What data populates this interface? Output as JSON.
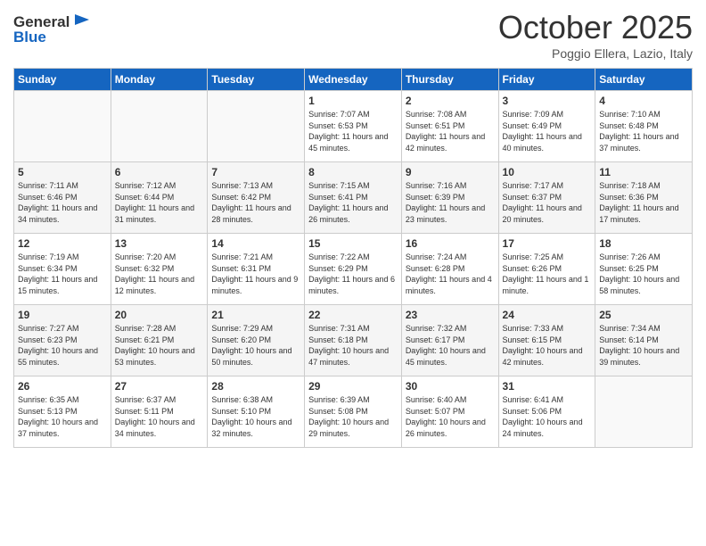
{
  "logo": {
    "general": "General",
    "blue": "Blue"
  },
  "header": {
    "month": "October 2025",
    "location": "Poggio Ellera, Lazio, Italy"
  },
  "weekdays": [
    "Sunday",
    "Monday",
    "Tuesday",
    "Wednesday",
    "Thursday",
    "Friday",
    "Saturday"
  ],
  "weeks": [
    [
      {
        "day": "",
        "sunrise": "",
        "sunset": "",
        "daylight": ""
      },
      {
        "day": "",
        "sunrise": "",
        "sunset": "",
        "daylight": ""
      },
      {
        "day": "",
        "sunrise": "",
        "sunset": "",
        "daylight": ""
      },
      {
        "day": "1",
        "sunrise": "Sunrise: 7:07 AM",
        "sunset": "Sunset: 6:53 PM",
        "daylight": "Daylight: 11 hours and 45 minutes."
      },
      {
        "day": "2",
        "sunrise": "Sunrise: 7:08 AM",
        "sunset": "Sunset: 6:51 PM",
        "daylight": "Daylight: 11 hours and 42 minutes."
      },
      {
        "day": "3",
        "sunrise": "Sunrise: 7:09 AM",
        "sunset": "Sunset: 6:49 PM",
        "daylight": "Daylight: 11 hours and 40 minutes."
      },
      {
        "day": "4",
        "sunrise": "Sunrise: 7:10 AM",
        "sunset": "Sunset: 6:48 PM",
        "daylight": "Daylight: 11 hours and 37 minutes."
      }
    ],
    [
      {
        "day": "5",
        "sunrise": "Sunrise: 7:11 AM",
        "sunset": "Sunset: 6:46 PM",
        "daylight": "Daylight: 11 hours and 34 minutes."
      },
      {
        "day": "6",
        "sunrise": "Sunrise: 7:12 AM",
        "sunset": "Sunset: 6:44 PM",
        "daylight": "Daylight: 11 hours and 31 minutes."
      },
      {
        "day": "7",
        "sunrise": "Sunrise: 7:13 AM",
        "sunset": "Sunset: 6:42 PM",
        "daylight": "Daylight: 11 hours and 28 minutes."
      },
      {
        "day": "8",
        "sunrise": "Sunrise: 7:15 AM",
        "sunset": "Sunset: 6:41 PM",
        "daylight": "Daylight: 11 hours and 26 minutes."
      },
      {
        "day": "9",
        "sunrise": "Sunrise: 7:16 AM",
        "sunset": "Sunset: 6:39 PM",
        "daylight": "Daylight: 11 hours and 23 minutes."
      },
      {
        "day": "10",
        "sunrise": "Sunrise: 7:17 AM",
        "sunset": "Sunset: 6:37 PM",
        "daylight": "Daylight: 11 hours and 20 minutes."
      },
      {
        "day": "11",
        "sunrise": "Sunrise: 7:18 AM",
        "sunset": "Sunset: 6:36 PM",
        "daylight": "Daylight: 11 hours and 17 minutes."
      }
    ],
    [
      {
        "day": "12",
        "sunrise": "Sunrise: 7:19 AM",
        "sunset": "Sunset: 6:34 PM",
        "daylight": "Daylight: 11 hours and 15 minutes."
      },
      {
        "day": "13",
        "sunrise": "Sunrise: 7:20 AM",
        "sunset": "Sunset: 6:32 PM",
        "daylight": "Daylight: 11 hours and 12 minutes."
      },
      {
        "day": "14",
        "sunrise": "Sunrise: 7:21 AM",
        "sunset": "Sunset: 6:31 PM",
        "daylight": "Daylight: 11 hours and 9 minutes."
      },
      {
        "day": "15",
        "sunrise": "Sunrise: 7:22 AM",
        "sunset": "Sunset: 6:29 PM",
        "daylight": "Daylight: 11 hours and 6 minutes."
      },
      {
        "day": "16",
        "sunrise": "Sunrise: 7:24 AM",
        "sunset": "Sunset: 6:28 PM",
        "daylight": "Daylight: 11 hours and 4 minutes."
      },
      {
        "day": "17",
        "sunrise": "Sunrise: 7:25 AM",
        "sunset": "Sunset: 6:26 PM",
        "daylight": "Daylight: 11 hours and 1 minute."
      },
      {
        "day": "18",
        "sunrise": "Sunrise: 7:26 AM",
        "sunset": "Sunset: 6:25 PM",
        "daylight": "Daylight: 10 hours and 58 minutes."
      }
    ],
    [
      {
        "day": "19",
        "sunrise": "Sunrise: 7:27 AM",
        "sunset": "Sunset: 6:23 PM",
        "daylight": "Daylight: 10 hours and 55 minutes."
      },
      {
        "day": "20",
        "sunrise": "Sunrise: 7:28 AM",
        "sunset": "Sunset: 6:21 PM",
        "daylight": "Daylight: 10 hours and 53 minutes."
      },
      {
        "day": "21",
        "sunrise": "Sunrise: 7:29 AM",
        "sunset": "Sunset: 6:20 PM",
        "daylight": "Daylight: 10 hours and 50 minutes."
      },
      {
        "day": "22",
        "sunrise": "Sunrise: 7:31 AM",
        "sunset": "Sunset: 6:18 PM",
        "daylight": "Daylight: 10 hours and 47 minutes."
      },
      {
        "day": "23",
        "sunrise": "Sunrise: 7:32 AM",
        "sunset": "Sunset: 6:17 PM",
        "daylight": "Daylight: 10 hours and 45 minutes."
      },
      {
        "day": "24",
        "sunrise": "Sunrise: 7:33 AM",
        "sunset": "Sunset: 6:15 PM",
        "daylight": "Daylight: 10 hours and 42 minutes."
      },
      {
        "day": "25",
        "sunrise": "Sunrise: 7:34 AM",
        "sunset": "Sunset: 6:14 PM",
        "daylight": "Daylight: 10 hours and 39 minutes."
      }
    ],
    [
      {
        "day": "26",
        "sunrise": "Sunrise: 6:35 AM",
        "sunset": "Sunset: 5:13 PM",
        "daylight": "Daylight: 10 hours and 37 minutes."
      },
      {
        "day": "27",
        "sunrise": "Sunrise: 6:37 AM",
        "sunset": "Sunset: 5:11 PM",
        "daylight": "Daylight: 10 hours and 34 minutes."
      },
      {
        "day": "28",
        "sunrise": "Sunrise: 6:38 AM",
        "sunset": "Sunset: 5:10 PM",
        "daylight": "Daylight: 10 hours and 32 minutes."
      },
      {
        "day": "29",
        "sunrise": "Sunrise: 6:39 AM",
        "sunset": "Sunset: 5:08 PM",
        "daylight": "Daylight: 10 hours and 29 minutes."
      },
      {
        "day": "30",
        "sunrise": "Sunrise: 6:40 AM",
        "sunset": "Sunset: 5:07 PM",
        "daylight": "Daylight: 10 hours and 26 minutes."
      },
      {
        "day": "31",
        "sunrise": "Sunrise: 6:41 AM",
        "sunset": "Sunset: 5:06 PM",
        "daylight": "Daylight: 10 hours and 24 minutes."
      },
      {
        "day": "",
        "sunrise": "",
        "sunset": "",
        "daylight": ""
      }
    ]
  ]
}
